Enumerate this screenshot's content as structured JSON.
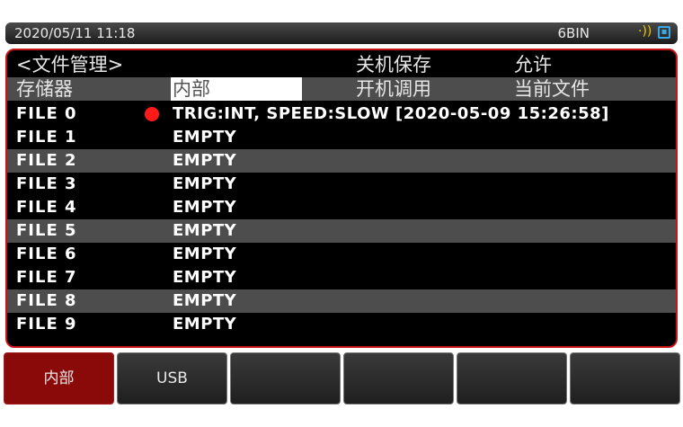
{
  "status": {
    "datetime": "2020/05/11  11:18",
    "mode": "6BIN",
    "icons": [
      "signal-icon",
      "usb-drive-icon"
    ]
  },
  "header": {
    "title": "<文件管理>",
    "storage_label": "存储器",
    "storage_value": "内部",
    "shutdown_save_label": "关机保存",
    "shutdown_save_value": "允许",
    "power_on_recall_label": "开机调用",
    "power_on_recall_value": "当前文件"
  },
  "files": [
    {
      "name": "FILE 0",
      "value": "TRIG:INT, SPEED:SLOW  [2020-05-09  15:26:58]",
      "current": true
    },
    {
      "name": "FILE 1",
      "value": "EMPTY"
    },
    {
      "name": "FILE 2",
      "value": "EMPTY"
    },
    {
      "name": "FILE 3",
      "value": "EMPTY"
    },
    {
      "name": "FILE 4",
      "value": "EMPTY"
    },
    {
      "name": "FILE 5",
      "value": "EMPTY"
    },
    {
      "name": "FILE 6",
      "value": "EMPTY"
    },
    {
      "name": "FILE 7",
      "value": "EMPTY"
    },
    {
      "name": "FILE 8",
      "value": "EMPTY"
    },
    {
      "name": "FILE 9",
      "value": "EMPTY"
    }
  ],
  "softkeys": [
    "内部",
    "USB",
    "",
    "",
    "",
    ""
  ],
  "colors": {
    "accent_border": "#c81414",
    "active_key": "#8a0a0a",
    "current_marker": "#ff1a1a",
    "alt_row": "#4d4d4d"
  }
}
